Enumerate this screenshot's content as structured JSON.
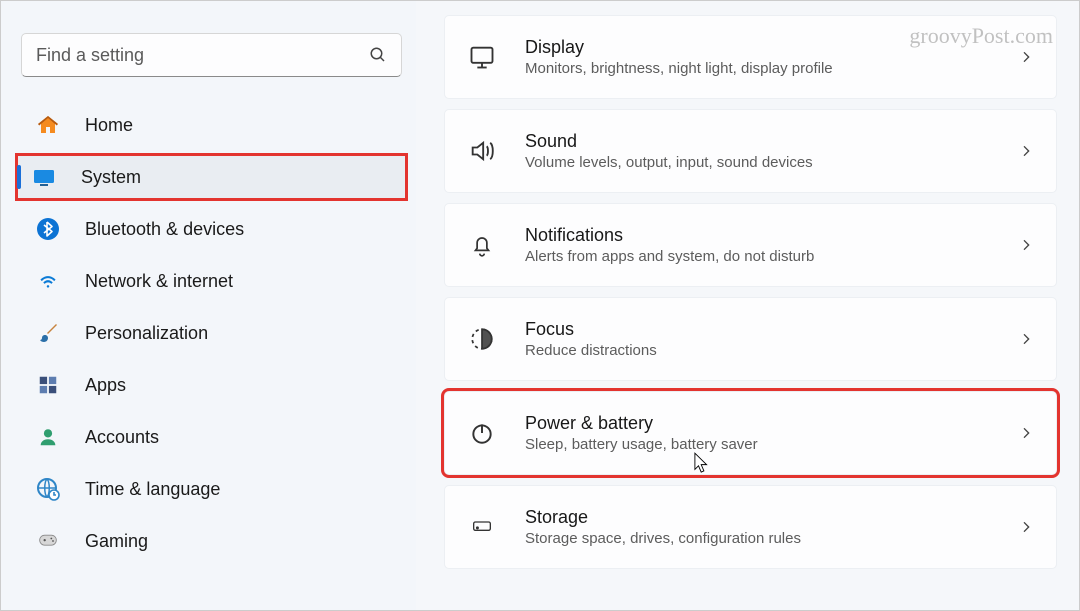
{
  "watermark": "groovyPost.com",
  "search": {
    "placeholder": "Find a setting"
  },
  "sidebar": {
    "items": [
      {
        "label": "Home"
      },
      {
        "label": "System"
      },
      {
        "label": "Bluetooth & devices"
      },
      {
        "label": "Network & internet"
      },
      {
        "label": "Personalization"
      },
      {
        "label": "Apps"
      },
      {
        "label": "Accounts"
      },
      {
        "label": "Time & language"
      },
      {
        "label": "Gaming"
      }
    ]
  },
  "settings": [
    {
      "title": "Display",
      "sub": "Monitors, brightness, night light, display profile"
    },
    {
      "title": "Sound",
      "sub": "Volume levels, output, input, sound devices"
    },
    {
      "title": "Notifications",
      "sub": "Alerts from apps and system, do not disturb"
    },
    {
      "title": "Focus",
      "sub": "Reduce distractions"
    },
    {
      "title": "Power & battery",
      "sub": "Sleep, battery usage, battery saver"
    },
    {
      "title": "Storage",
      "sub": "Storage space, drives, configuration rules"
    }
  ]
}
